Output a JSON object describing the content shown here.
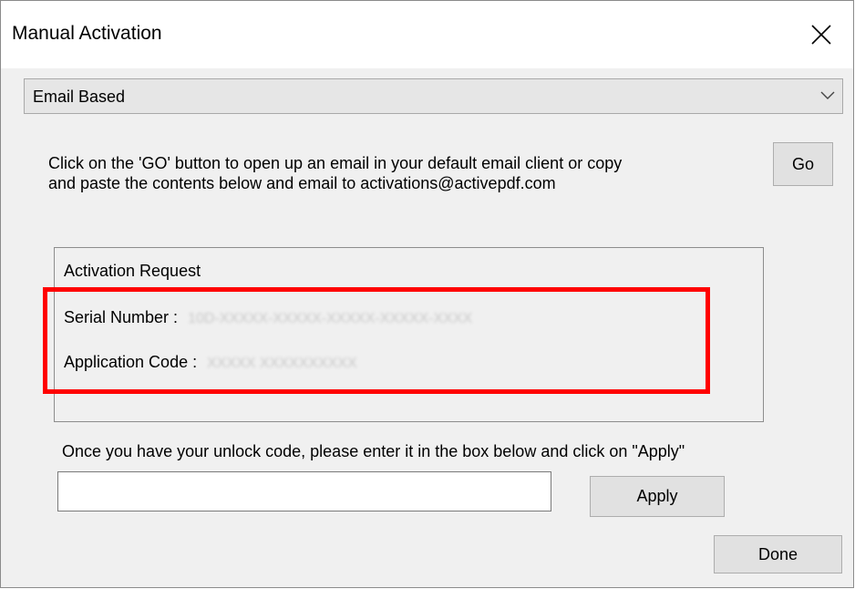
{
  "window": {
    "title": "Manual Activation",
    "close_icon": "close-icon"
  },
  "activation_method": {
    "selected": "Email Based",
    "chevron_icon": "chevron-down-icon"
  },
  "instructions": {
    "line1": "Click on the 'GO' button to open up an email in your default email client or copy",
    "line2": "and paste the contents below and email to activations@activepdf.com",
    "go_label": "Go"
  },
  "activation_request": {
    "legend": "Activation Request",
    "serial_label": "Serial Number :",
    "serial_value": "10D-XXXXX-XXXXX-XXXXX-XXXXX-XXXX",
    "app_code_label": "Application Code :",
    "app_code_value": "XXXXX XXXXXXXXXX",
    "highlight_color": "#ff0000"
  },
  "unlock": {
    "instruction": "Once you have your unlock code, please enter it in the box below and click on \"Apply\"",
    "value": "",
    "apply_label": "Apply"
  },
  "footer": {
    "done_label": "Done"
  }
}
